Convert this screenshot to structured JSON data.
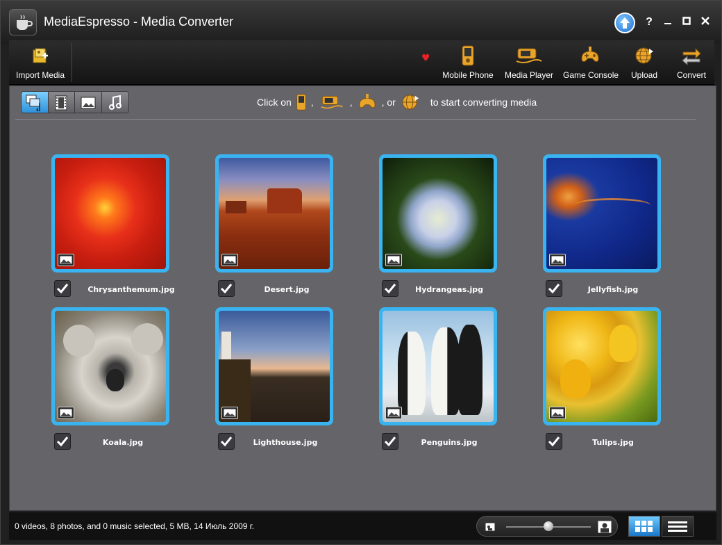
{
  "window": {
    "title": "MediaEspresso - Media Converter",
    "help_label": "?",
    "upgrade_icon": "up-arrow-icon"
  },
  "toolbar": {
    "import_label": "Import Media",
    "devices": [
      {
        "label": "Mobile Phone",
        "icon": "mobile-phone-icon"
      },
      {
        "label": "Media Player",
        "icon": "media-player-icon"
      },
      {
        "label": "Game Console",
        "icon": "game-console-icon"
      },
      {
        "label": "Upload",
        "icon": "upload-globe-icon"
      },
      {
        "label": "Convert",
        "icon": "convert-arrows-icon"
      }
    ]
  },
  "filters": [
    {
      "name": "all-media",
      "active": true
    },
    {
      "name": "video",
      "active": false
    },
    {
      "name": "photo",
      "active": false
    },
    {
      "name": "music",
      "active": false
    }
  ],
  "hint": {
    "prefix": "Click on",
    "sep1": ",",
    "sep2": ",",
    "sep3": ", or",
    "suffix": "to start converting media"
  },
  "media": [
    {
      "name": "Chrysanthemum.jpg",
      "checked": true
    },
    {
      "name": "Desert.jpg",
      "checked": true
    },
    {
      "name": "Hydrangeas.jpg",
      "checked": true
    },
    {
      "name": "Jellyfish.jpg",
      "checked": true
    },
    {
      "name": "Koala.jpg",
      "checked": true
    },
    {
      "name": "Lighthouse.jpg",
      "checked": true
    },
    {
      "name": "Penguins.jpg",
      "checked": true
    },
    {
      "name": "Tulips.jpg",
      "checked": true
    }
  ],
  "status": {
    "text": "0 videos, 8 photos, and 0 music selected, 5 MB, 14 Июль 2009 г.",
    "zoom_level": 0.5,
    "view_mode": "grid"
  },
  "colors": {
    "selection_blue": "#3ab4f0",
    "panel_gray": "#646469"
  }
}
